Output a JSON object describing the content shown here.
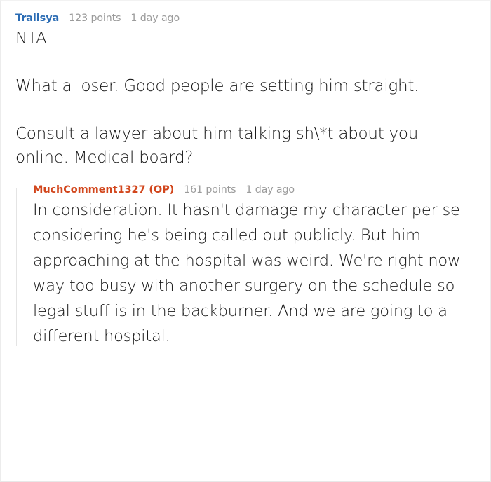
{
  "thread": {
    "top_comment": {
      "author": "Trailsya",
      "points": "123 points",
      "age": "1 day ago",
      "author_color": "#2b6cb4",
      "paragraphs": [
        "NTA",
        "What a loser. Good people are setting him straight.",
        "Consult a lawyer about him talking sh\\*t about you online. Medical board?"
      ]
    },
    "reply": {
      "author": "MuchComment1327 (OP)",
      "points": "161 points",
      "age": "1 day ago",
      "author_color": "#d2461c",
      "paragraphs": [
        "In consideration. It hasn't damage my character per se considering he's being called out publicly. But him approaching at the hospital was weird. We're right now way too busy with another surgery on the schedule so legal stuff is in the backburner. And we are going to a different hospital."
      ]
    }
  }
}
